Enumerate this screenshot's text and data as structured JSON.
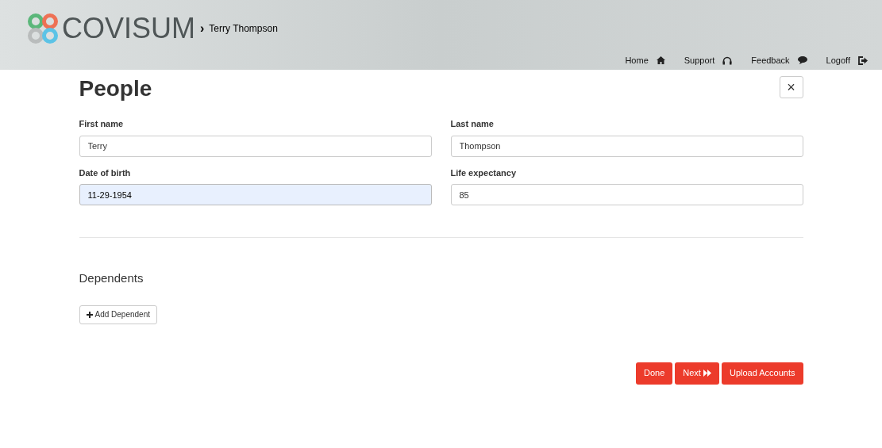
{
  "header": {
    "logo_text": "COVISUM",
    "breadcrumb_separator": "›",
    "breadcrumb": "Terry Thompson",
    "nav": [
      {
        "label": "Home",
        "kind": "home"
      },
      {
        "label": "Support",
        "kind": "support"
      },
      {
        "label": "Feedback",
        "kind": "feedback"
      },
      {
        "label": "Logoff",
        "kind": "logoff"
      }
    ]
  },
  "page": {
    "title": "People",
    "close": "×"
  },
  "fields": [
    {
      "label": "First name",
      "value": "Terry",
      "highlighted": false
    },
    {
      "label": "Last name",
      "value": "Thompson",
      "highlighted": false
    },
    {
      "label": "Date of birth",
      "value": "11-29-1954",
      "highlighted": true
    },
    {
      "label": "Life expectancy",
      "value": "85",
      "highlighted": false
    }
  ],
  "dependents": {
    "heading": "Dependents",
    "add_button": "Add Dependent"
  },
  "actions": [
    {
      "label": "Done",
      "kind": "plain"
    },
    {
      "label": "Next",
      "kind": "next"
    },
    {
      "label": "Upload Accounts",
      "kind": "plain"
    }
  ]
}
